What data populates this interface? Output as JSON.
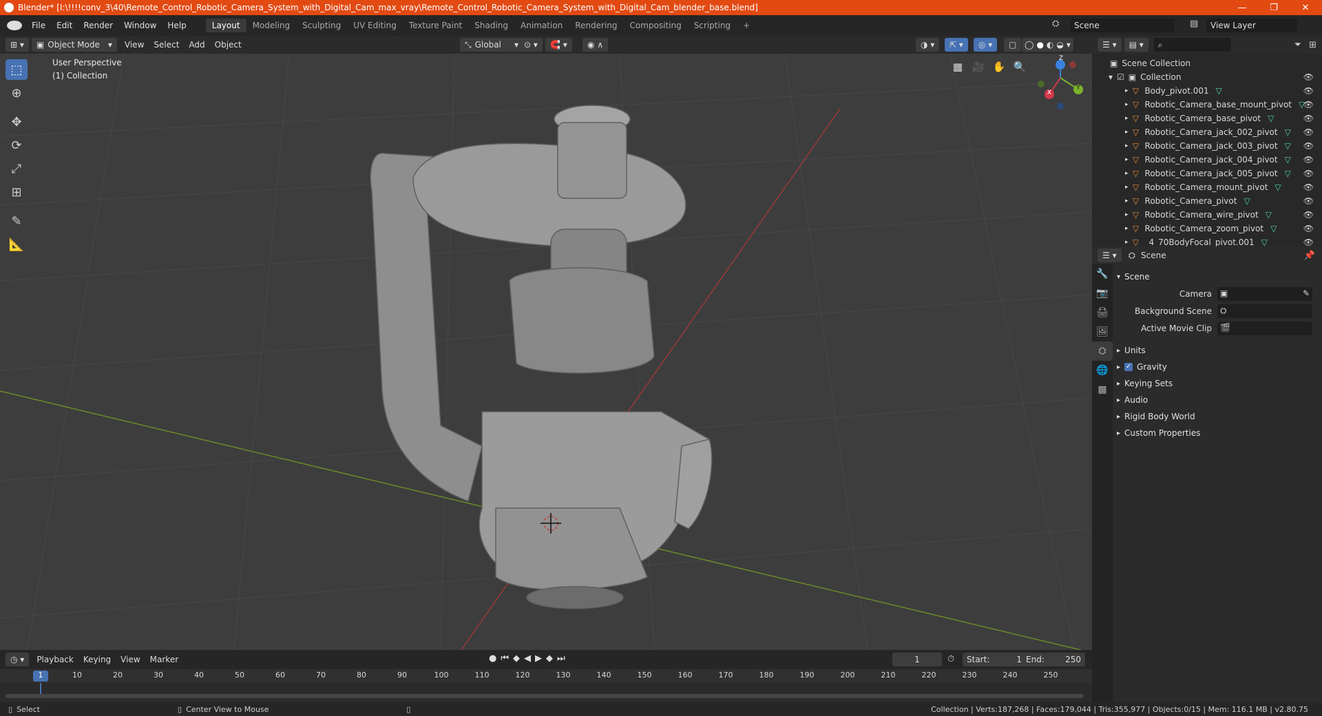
{
  "window": {
    "title": "Blender* [I:\\!!!!conv_3\\40\\Remote_Control_Robotic_Camera_System_with_Digital_Cam_max_vray\\Remote_Control_Robotic_Camera_System_with_Digital_Cam_blender_base.blend]",
    "minimize": "—",
    "maximize": "❐",
    "close": "✕"
  },
  "menu": [
    "File",
    "Edit",
    "Render",
    "Window",
    "Help"
  ],
  "workspaces": [
    "Layout",
    "Modeling",
    "Sculpting",
    "UV Editing",
    "Texture Paint",
    "Shading",
    "Animation",
    "Rendering",
    "Compositing",
    "Scripting"
  ],
  "add_workspace": "+",
  "scene_field": "Scene",
  "viewlayer_field": "View Layer",
  "viewport_header": {
    "mode": "Object Mode",
    "menus": [
      "View",
      "Select",
      "Add",
      "Object"
    ],
    "transform": "Global"
  },
  "viewport": {
    "perspective": "User Perspective",
    "collection": "(1) Collection",
    "gizmo": {
      "x": "X",
      "y": "Y",
      "z": "Z"
    }
  },
  "outliner": {
    "search_placeholder": "",
    "scene_collection": "Scene Collection",
    "collection": "Collection",
    "items": [
      "Body_pivot.001",
      "Robotic_Camera_base_mount_pivot",
      "Robotic_Camera_base_pivot",
      "Robotic_Camera_jack_002_pivot",
      "Robotic_Camera_jack_003_pivot",
      "Robotic_Camera_jack_004_pivot",
      "Robotic_Camera_jack_005_pivot",
      "Robotic_Camera_mount_pivot",
      "Robotic_Camera_pivot",
      "Robotic_Camera_wire_pivot",
      "Robotic_Camera_zoom_pivot",
      "_4_70BodyFocal_pivot.001"
    ]
  },
  "properties": {
    "header": "Scene",
    "section": "Scene",
    "fields": [
      "Camera",
      "Background Scene",
      "Active Movie Clip"
    ],
    "subsections": [
      "Units",
      "Gravity",
      "Keying Sets",
      "Audio",
      "Rigid Body World",
      "Custom Properties"
    ],
    "gravity_checked": true
  },
  "timeline": {
    "menus": [
      "Playback",
      "Keying",
      "View",
      "Marker"
    ],
    "current_frame": "1",
    "start_label": "Start:",
    "start": "1",
    "end_label": "End:",
    "end": "250",
    "ticks": [
      "1",
      "10",
      "20",
      "30",
      "40",
      "50",
      "60",
      "70",
      "80",
      "90",
      "100",
      "110",
      "120",
      "130",
      "140",
      "150",
      "160",
      "170",
      "180",
      "190",
      "200",
      "210",
      "220",
      "230",
      "240",
      "250"
    ]
  },
  "status": {
    "left1": "Select",
    "left2": "Center View to Mouse",
    "right": "Collection | Verts:187,268 | Faces:179,044 | Tris:355,977 | Objects:0/15 | Mem: 116.1 MB | v2.80.75"
  },
  "colors": {
    "accent": "#4772b3",
    "titlebar": "#e24a12",
    "mesh_icon": "#52d4b0",
    "object_icon": "#e58d3b"
  }
}
